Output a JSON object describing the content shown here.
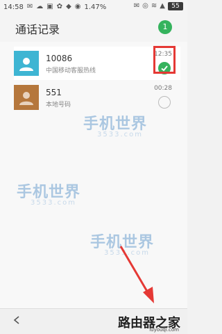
{
  "status_bar": {
    "time": "14:58",
    "battery_percent": "1.47%",
    "battery_level": "55",
    "icons": [
      "chat-icon",
      "weather-icon",
      "image-icon",
      "paw-icon",
      "app-icon",
      "mic-icon",
      "message-icon",
      "android-icon",
      "wifi-icon",
      "signal-icon"
    ]
  },
  "header": {
    "title": "通话记录",
    "selected_count": "1"
  },
  "calls": [
    {
      "number": "10086",
      "description": "中国移动客服热线",
      "time": "12:35",
      "selected": true,
      "avatar_color": "#3eb5d3"
    },
    {
      "number": "551",
      "description": "本地号码",
      "time": "00:28",
      "selected": false,
      "avatar_color": "#b5773c"
    }
  ],
  "watermark": {
    "text": "手机世界",
    "sub": "3533.com"
  },
  "bottom_bar": {
    "label": "路由器之家",
    "sub": "luyouqi.com"
  },
  "colors": {
    "accent": "#35b35d",
    "highlight": "#e53935",
    "annotation_arrow": "#e53935"
  }
}
